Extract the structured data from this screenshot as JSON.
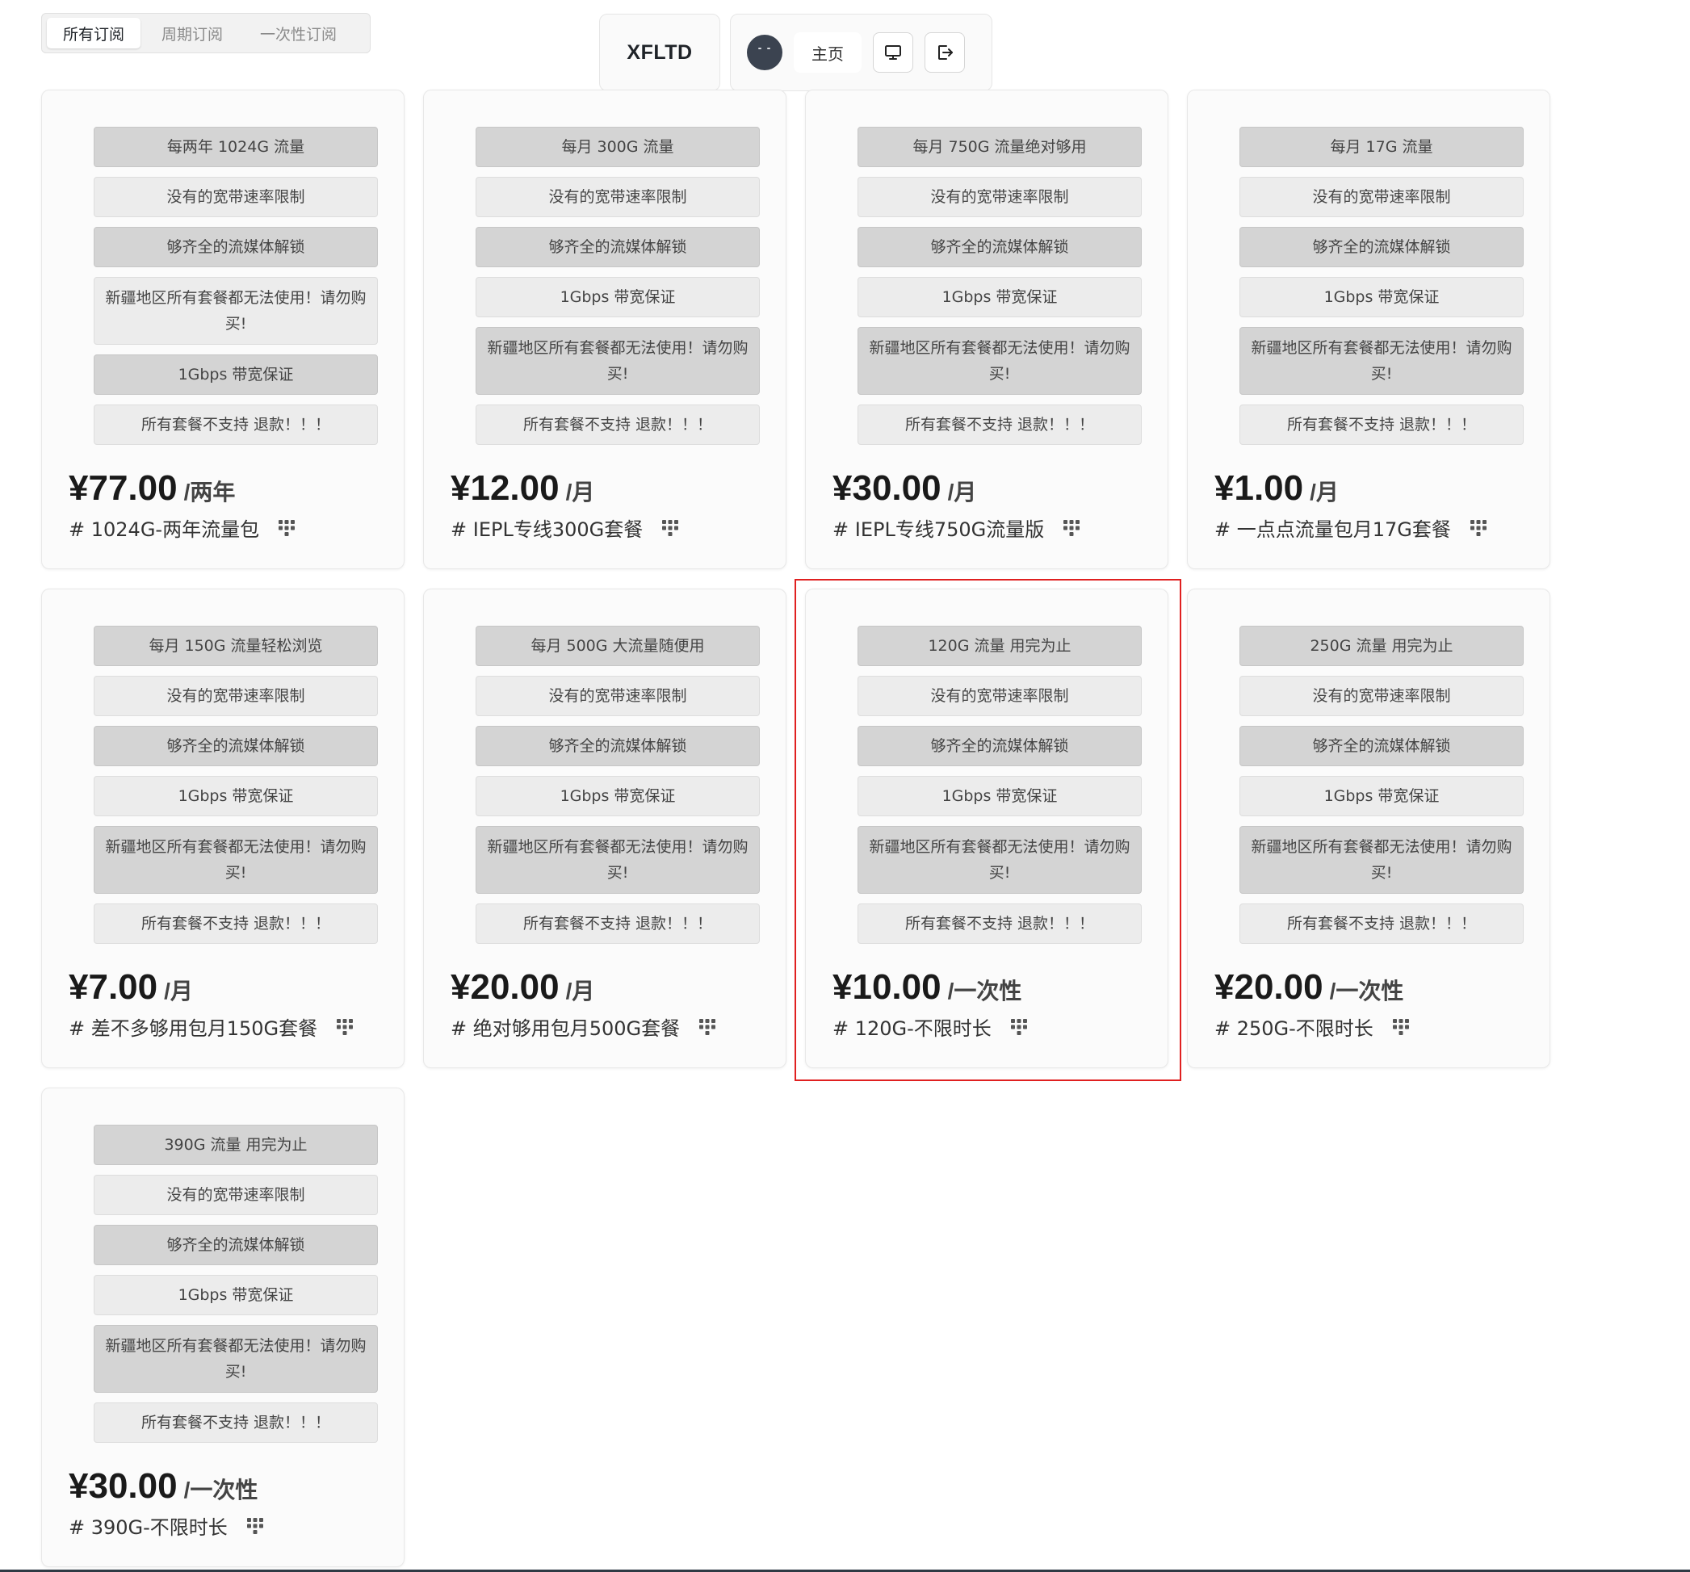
{
  "tabs": [
    {
      "label": "所有订阅"
    },
    {
      "label": "周期订阅"
    },
    {
      "label": "一次性订阅"
    }
  ],
  "brand": "XFLTD",
  "nav": {
    "home_label": "主页",
    "icons": [
      "monitor-icon",
      "logout-icon"
    ]
  },
  "colors": {
    "highlight": "#e02020",
    "feature_dark": "#d4d4d4",
    "feature_light": "#ececec"
  },
  "plans": [
    {
      "features": [
        "每两年 1024G 流量",
        "没有的宽带速率限制",
        "够齐全的流媒体解锁",
        "新疆地区所有套餐都无法使用！请勿购买!",
        "1Gbps 带宽保证",
        "所有套餐不支持 退款！！！"
      ],
      "price": "¥77.00",
      "period": "/两年",
      "name": "# 1024G-两年流量包"
    },
    {
      "features": [
        "每月 300G 流量",
        "没有的宽带速率限制",
        "够齐全的流媒体解锁",
        "1Gbps 带宽保证",
        "新疆地区所有套餐都无法使用！请勿购买!",
        "所有套餐不支持 退款！！！"
      ],
      "price": "¥12.00",
      "period": "/月",
      "name": "# IEPL专线300G套餐"
    },
    {
      "features": [
        "每月 750G 流量绝对够用",
        "没有的宽带速率限制",
        "够齐全的流媒体解锁",
        "1Gbps 带宽保证",
        "新疆地区所有套餐都无法使用！请勿购买!",
        "所有套餐不支持 退款！！！"
      ],
      "price": "¥30.00",
      "period": "/月",
      "name": "# IEPL专线750G流量版"
    },
    {
      "features": [
        "每月 17G 流量",
        "没有的宽带速率限制",
        "够齐全的流媒体解锁",
        "1Gbps 带宽保证",
        "新疆地区所有套餐都无法使用！请勿购买!",
        "所有套餐不支持 退款！！！"
      ],
      "price": "¥1.00",
      "period": "/月",
      "name": "# 一点点流量包月17G套餐"
    },
    {
      "features": [
        "每月 150G 流量轻松浏览",
        "没有的宽带速率限制",
        "够齐全的流媒体解锁",
        "1Gbps 带宽保证",
        "新疆地区所有套餐都无法使用！请勿购买!",
        "所有套餐不支持 退款！！！"
      ],
      "price": "¥7.00",
      "period": "/月",
      "name": "# 差不多够用包月150G套餐"
    },
    {
      "features": [
        "每月 500G 大流量随便用",
        "没有的宽带速率限制",
        "够齐全的流媒体解锁",
        "1Gbps 带宽保证",
        "新疆地区所有套餐都无法使用！请勿购买!",
        "所有套餐不支持 退款！！！"
      ],
      "price": "¥20.00",
      "period": "/月",
      "name": "# 绝对够用包月500G套餐"
    },
    {
      "features": [
        "120G 流量 用完为止",
        "没有的宽带速率限制",
        "够齐全的流媒体解锁",
        "1Gbps 带宽保证",
        "新疆地区所有套餐都无法使用！请勿购买!",
        "所有套餐不支持 退款！！！"
      ],
      "price": "¥10.00",
      "period": "/一次性",
      "name": "# 120G-不限时长"
    },
    {
      "features": [
        "250G 流量 用完为止",
        "没有的宽带速率限制",
        "够齐全的流媒体解锁",
        "1Gbps 带宽保证",
        "新疆地区所有套餐都无法使用！请勿购买!",
        "所有套餐不支持 退款！！！"
      ],
      "price": "¥20.00",
      "period": "/一次性",
      "name": "# 250G-不限时长"
    },
    {
      "features": [
        "390G 流量 用完为止",
        "没有的宽带速率限制",
        "够齐全的流媒体解锁",
        "1Gbps 带宽保证",
        "新疆地区所有套餐都无法使用！请勿购买!",
        "所有套餐不支持 退款！！！"
      ],
      "price": "¥30.00",
      "period": "/一次性",
      "name": "# 390G-不限时长"
    }
  ]
}
